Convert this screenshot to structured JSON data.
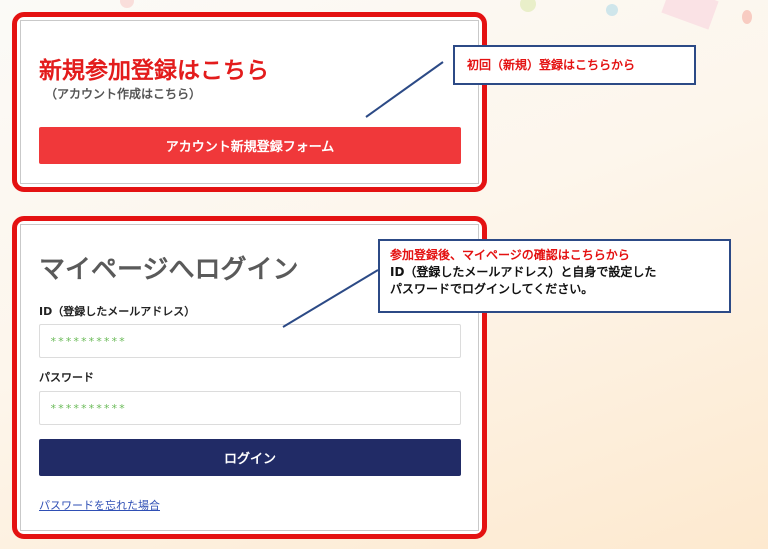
{
  "registration": {
    "title": "新規参加登録はこちら",
    "subtitle": "（アカウント作成はこちら）",
    "button_label": "アカウント新規登録フォーム"
  },
  "login": {
    "title": "マイページへログイン",
    "id_label": "ID（登録したメールアドレス）",
    "id_value": "**********",
    "password_label": "パスワード",
    "password_value": "**********",
    "button_label": "ログイン",
    "forgot_link": "パスワードを忘れた場合"
  },
  "callouts": {
    "registration_note": "初回（新規）登録はこちらから",
    "login_note_line1": "参加登録後、マイページの確認はこちらから",
    "login_note_line2": "ID（登録したメールアドレス）と自身で設定した",
    "login_note_line3": "パスワードでログインしてください。"
  },
  "colors": {
    "accent_red": "#e41212",
    "button_red": "#f0383a",
    "button_navy": "#212b66",
    "callout_border": "#2c4a86"
  }
}
